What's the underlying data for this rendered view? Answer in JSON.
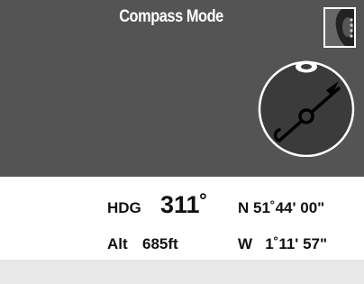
{
  "header": {
    "title": "Compass Mode"
  },
  "compass": {
    "icon": "compass-needle-icon",
    "heading_deg": 311
  },
  "info": {
    "heading_label": "HDG",
    "heading_value": "311˚",
    "latitude": "N 51˚44' 00\"",
    "altitude_label": "Alt",
    "altitude_value": "685ft",
    "longitude": "W   1˚11' 57\""
  },
  "colors": {
    "top_panel": "#545454",
    "info_panel": "#ffffff",
    "footer": "#e8e8e8"
  }
}
